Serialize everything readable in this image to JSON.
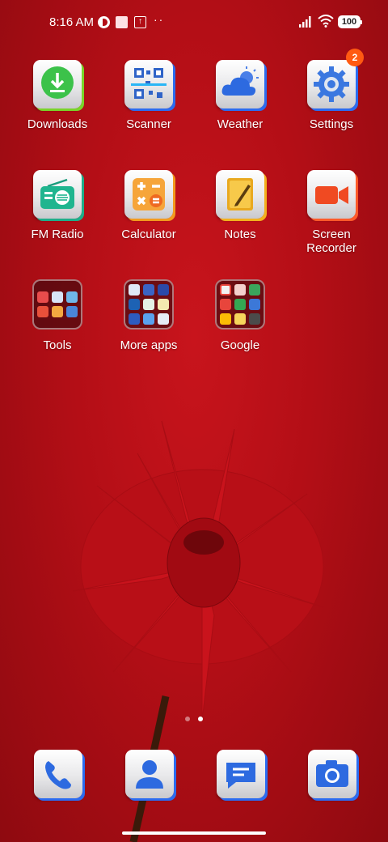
{
  "status_bar": {
    "time": "8:16 AM",
    "battery": "100",
    "icons": [
      "c-app-icon",
      "notification-square-icon",
      "upload-icon",
      "more-dots-icon",
      "signal-icon",
      "wifi-icon",
      "battery-icon"
    ]
  },
  "apps": [
    {
      "label": "Downloads",
      "icon": "download-icon"
    },
    {
      "label": "Scanner",
      "icon": "qr-scanner-icon"
    },
    {
      "label": "Weather",
      "icon": "weather-cloud-icon"
    },
    {
      "label": "Settings",
      "icon": "gear-icon",
      "badge": "2"
    },
    {
      "label": "FM Radio",
      "icon": "radio-icon"
    },
    {
      "label": "Calculator",
      "icon": "calculator-icon"
    },
    {
      "label": "Notes",
      "icon": "notes-icon"
    },
    {
      "label": "Screen Recorder",
      "icon": "video-camera-icon"
    },
    {
      "label": "Tools",
      "icon": "folder-icon"
    },
    {
      "label": "More apps",
      "icon": "folder-icon"
    },
    {
      "label": "Google",
      "icon": "folder-icon"
    }
  ],
  "dock": [
    {
      "name": "Phone",
      "icon": "phone-icon"
    },
    {
      "name": "Contacts",
      "icon": "contacts-icon"
    },
    {
      "name": "Messages",
      "icon": "message-icon"
    },
    {
      "name": "Camera",
      "icon": "camera-icon"
    }
  ],
  "pages": {
    "count": 2,
    "active": 1
  },
  "colors": {
    "wallpaper": "#b30e16",
    "accent_shadow": "#2c6cf0",
    "badge": "#ff5a12"
  }
}
